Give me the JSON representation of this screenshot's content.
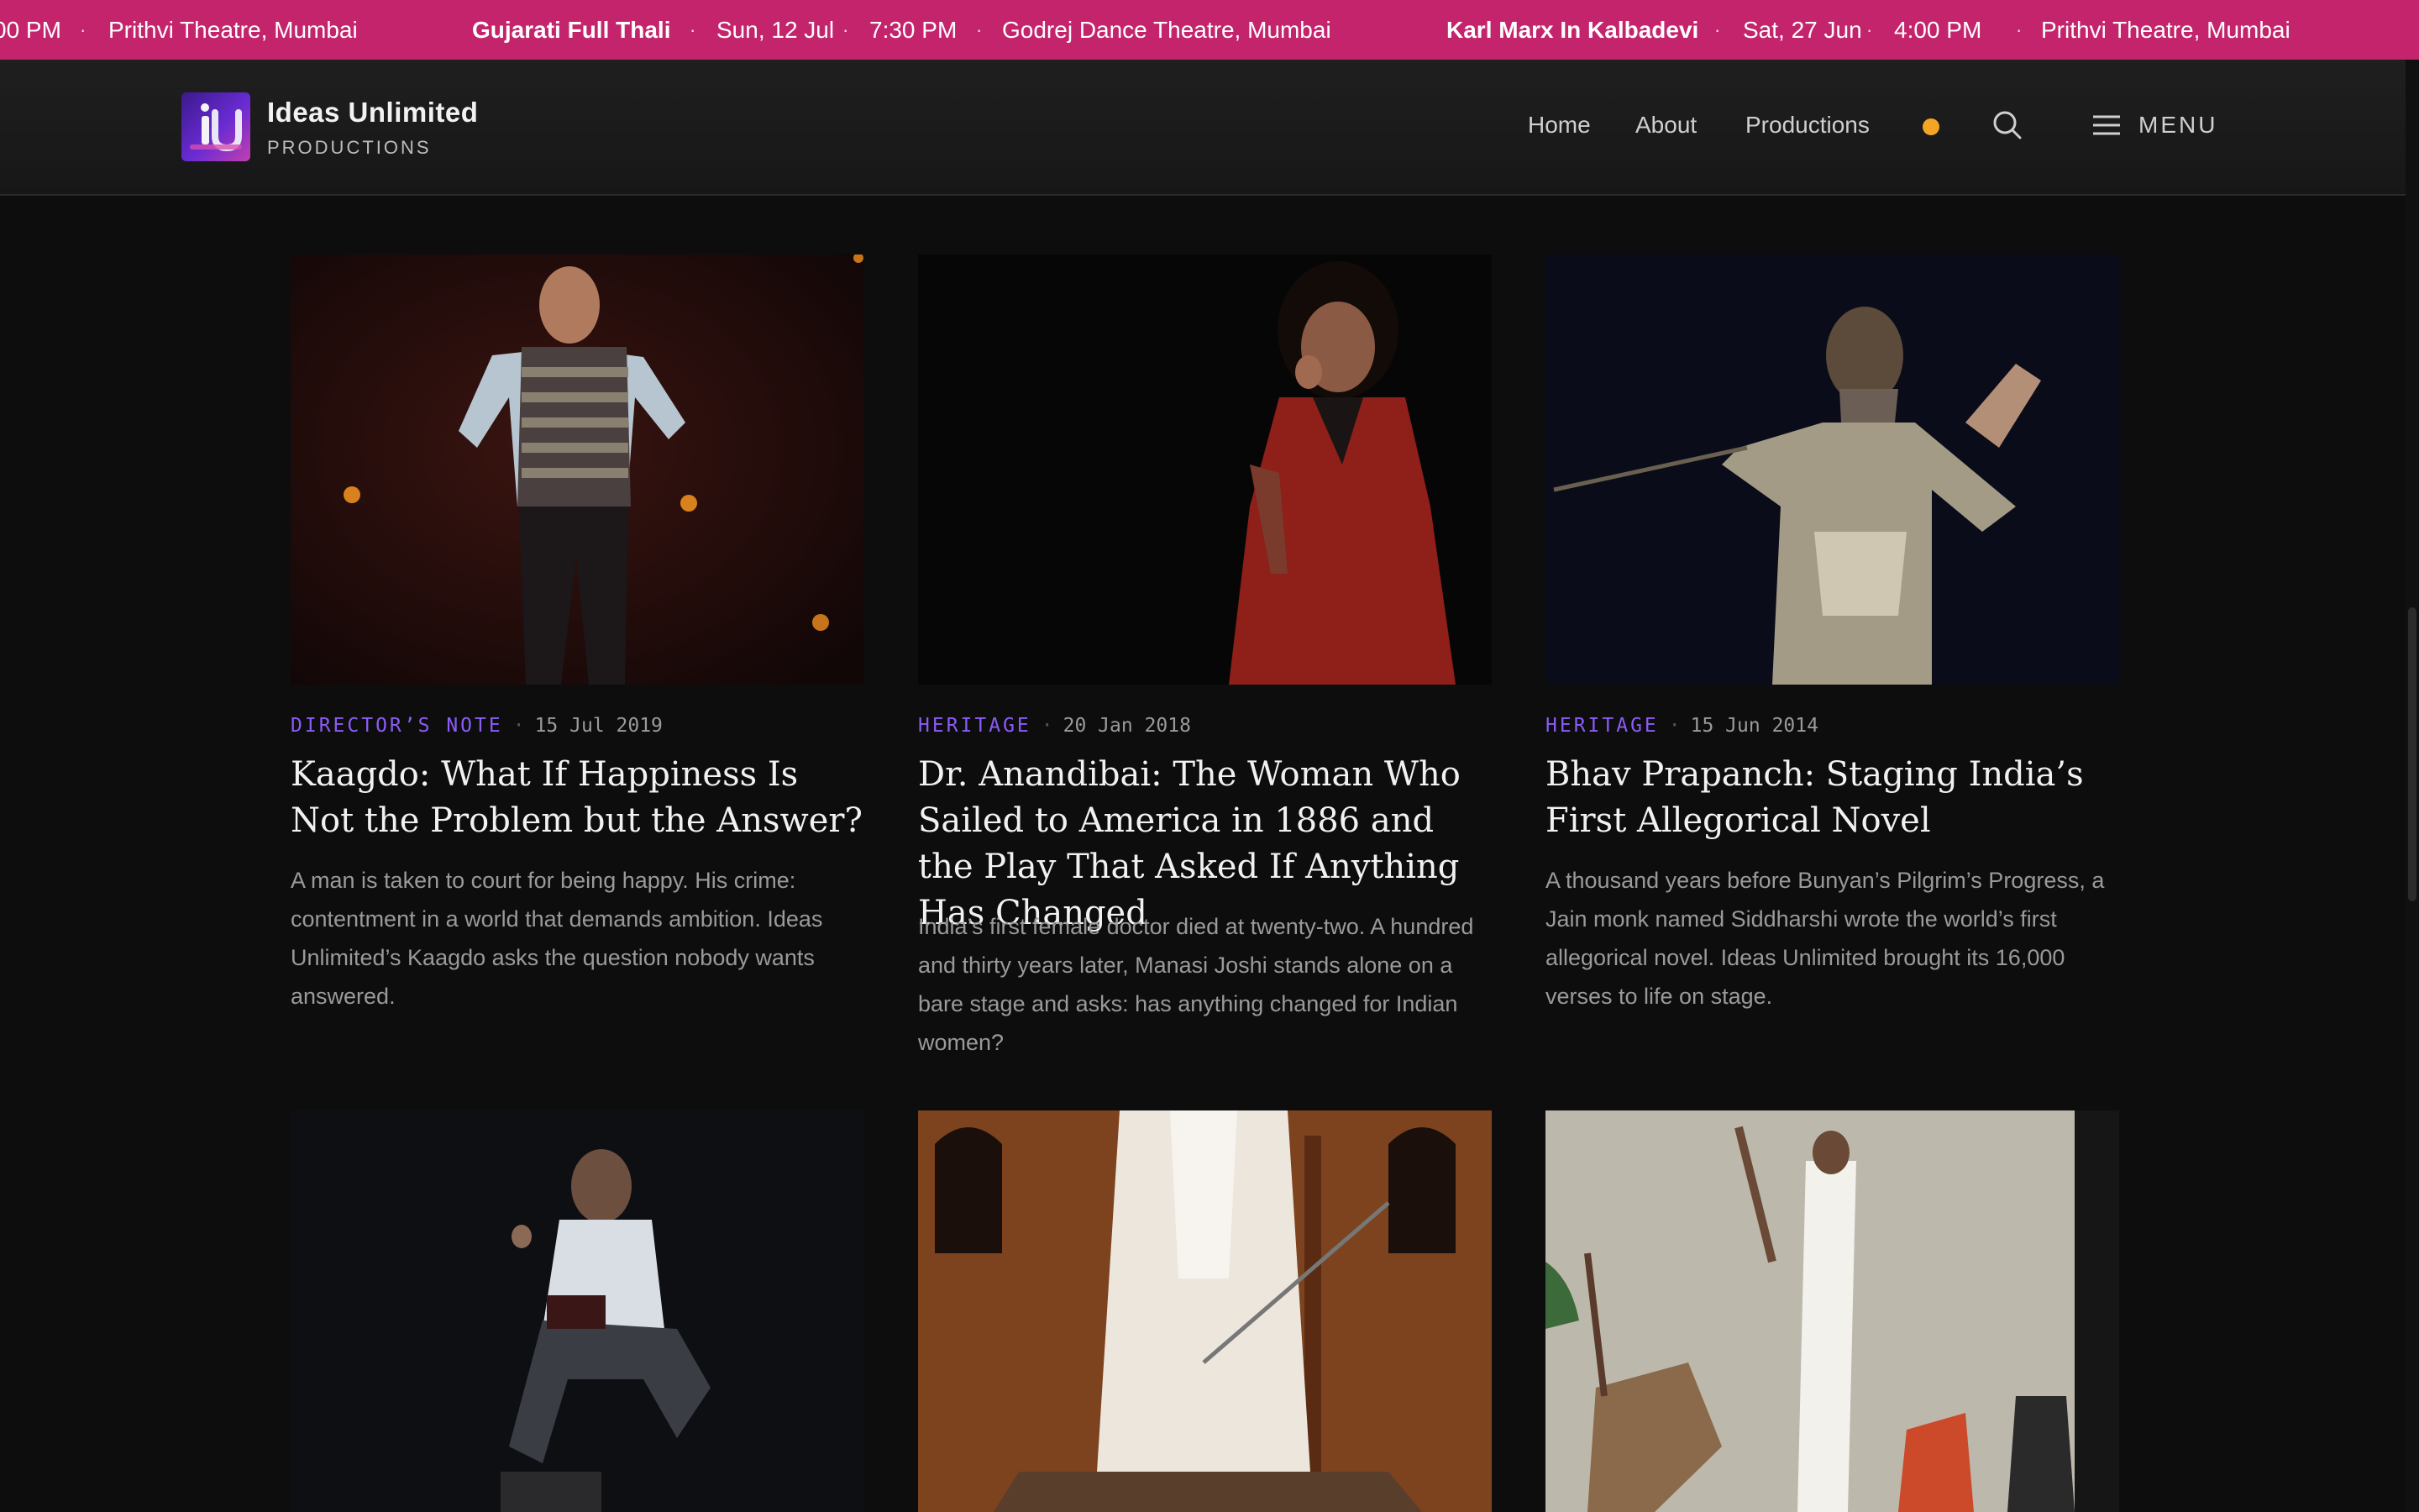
{
  "ticker": {
    "items": [
      {
        "text": "00 PM",
        "bold": false
      },
      {
        "text": "Prithvi Theatre, Mumbai",
        "bold": false
      },
      {
        "text": "Gujarati Full Thali",
        "bold": true
      },
      {
        "text": "Sun, 12 Jul",
        "bold": false
      },
      {
        "text": "7:30 PM",
        "bold": false
      },
      {
        "text": "Godrej Dance Theatre, Mumbai",
        "bold": false
      },
      {
        "text": "Karl Marx In Kalbadevi",
        "bold": true
      },
      {
        "text": "Sat, 27 Jun",
        "bold": false
      },
      {
        "text": "4:00 PM",
        "bold": false
      },
      {
        "text": "Prithvi Theatre, Mumbai",
        "bold": false
      }
    ],
    "separator": "·"
  },
  "brand": {
    "name": "Ideas Unlimited",
    "tagline": "PRODUCTIONS"
  },
  "nav": {
    "links": [
      "Home",
      "About",
      "Productions"
    ],
    "menu_label": "MENU"
  },
  "articles": [
    {
      "category": "DIRECTOR’S NOTE",
      "date": "15 Jul 2019",
      "title": "Kaagdo: What If Happiness Is Not the Problem but the Answer?",
      "excerpt": "A man is taken to court for being happy. His crime: contentment in a world that demands ambition. Ideas Unlimited’s Kaagdo asks the question nobody wants answered."
    },
    {
      "category": "HERITAGE",
      "date": "20 Jan 2018",
      "title": "Dr. Anandibai: The Woman Who Sailed to America in 1886 and the Play That Asked If Anything Has Changed",
      "excerpt": "India’s first female doctor died at twenty-two. A hundred and thirty years later, Manasi Joshi stands alone on a bare stage and asks: has anything changed for Indian women?"
    },
    {
      "category": "HERITAGE",
      "date": "15 Jun 2014",
      "title": "Bhav Prapanch: Staging India’s First Allegorical Novel",
      "excerpt": "A thousand years before Bunyan’s Pilgrim’s Progress, a Jain monk named Siddharshi wrote the world’s first allegorical novel. Ideas Unlimited brought its 16,000 verses to life on stage."
    }
  ],
  "colors": {
    "ticker_bg": "#c4246c",
    "category": "#8b5cf6",
    "status_dot": "#f2a623",
    "page_bg": "#0d0d0e"
  }
}
